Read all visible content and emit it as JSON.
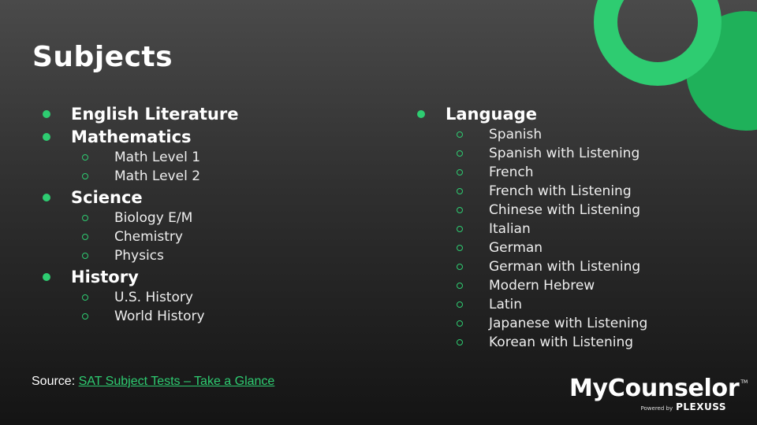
{
  "title": "Subjects",
  "colors": {
    "accent": "#2ecc71",
    "accent_dark": "#1fb15a"
  },
  "left_topics": [
    {
      "label": "English Literature",
      "subitems": []
    },
    {
      "label": "Mathematics",
      "subitems": [
        "Math Level 1",
        "Math Level 2"
      ]
    },
    {
      "label": "Science",
      "subitems": [
        "Biology E/M",
        "Chemistry",
        "Physics"
      ]
    },
    {
      "label": "History",
      "subitems": [
        "U.S. History",
        "World History"
      ]
    }
  ],
  "right_topics": [
    {
      "label": "Language",
      "subitems": [
        "Spanish",
        "Spanish with Listening",
        "French",
        "French with Listening",
        "Chinese with Listening",
        "Italian",
        "German",
        "German with Listening",
        "Modern Hebrew",
        "Latin",
        "Japanese with Listening",
        "Korean with Listening"
      ]
    }
  ],
  "source": {
    "prefix": "Source: ",
    "link_text": "SAT Subject Tests – Take a Glance"
  },
  "logo": {
    "name": "MyCounselor",
    "tm": "TM",
    "powered": "Powered by",
    "brand": "PLEXUSS"
  }
}
